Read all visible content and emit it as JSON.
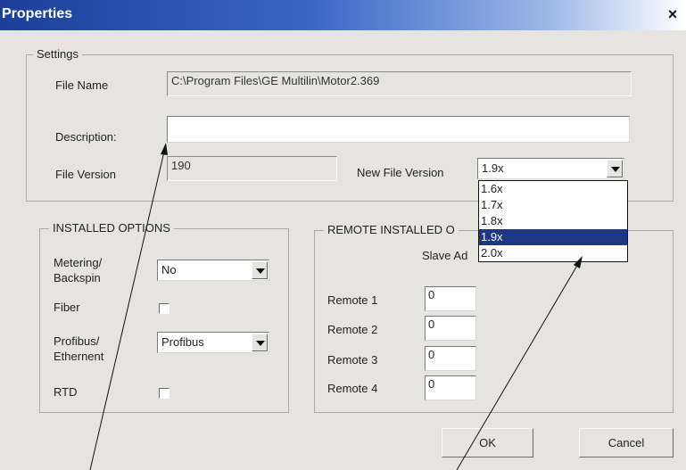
{
  "window": {
    "title": "Properties",
    "close_symbol": "×"
  },
  "settings": {
    "legend": "Settings",
    "file_name_label": "File Name",
    "file_name_value": "C:\\Program Files\\GE Multilin\\Motor2.369",
    "description_label": "Description:",
    "description_value": "",
    "file_version_label": "File Version",
    "file_version_value": "190",
    "new_file_version_label": "New File Version",
    "new_file_version_selected": "1.9x",
    "new_file_version_options": [
      "1.6x",
      "1.7x",
      "1.8x",
      "1.9x",
      "2.0x"
    ],
    "new_file_version_highlighted_index": 3
  },
  "installed_options": {
    "legend": "INSTALLED OPTIONS",
    "metering_label": "Metering/\nBackspin",
    "metering_value": "No",
    "fiber_label": "Fiber",
    "fiber_checked": false,
    "profibus_label": "Profibus/\nEthernent",
    "profibus_value": "Profibus",
    "rtd_label": "RTD",
    "rtd_checked": false
  },
  "remote_installed_options": {
    "legend": "REMOTE INSTALLED O",
    "slave_label": "Slave Ad",
    "rows": [
      {
        "label": "Remote 1",
        "value": "0"
      },
      {
        "label": "Remote 2",
        "value": "0"
      },
      {
        "label": "Remote 3",
        "value": "0"
      },
      {
        "label": "Remote 4",
        "value": "0"
      }
    ]
  },
  "buttons": {
    "ok": "OK",
    "cancel": "Cancel"
  },
  "colors": {
    "dialog_bg": "#e6e4e0",
    "titlebar": "#1c3f98",
    "selection": "#1d3783"
  },
  "icons": {
    "close": "close-icon",
    "dropdown": "chevron-down-icon",
    "annotation_arrows": "arrow-icon"
  }
}
